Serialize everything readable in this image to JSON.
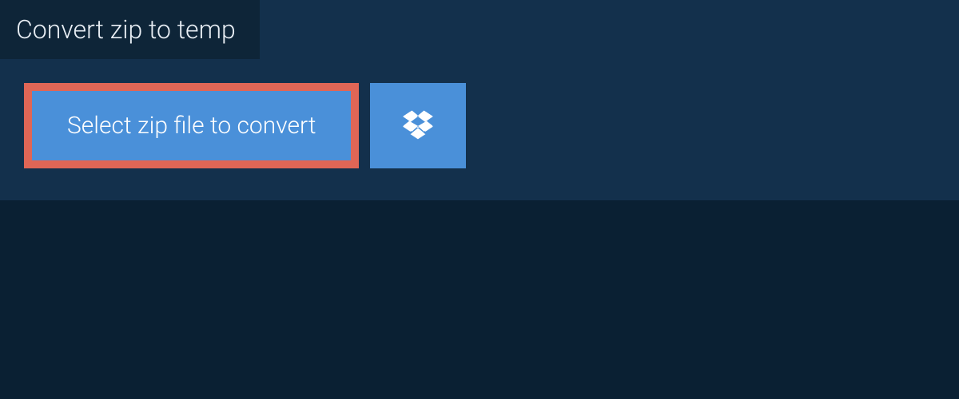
{
  "header": {
    "title": "Convert zip to temp"
  },
  "actions": {
    "select_file_label": "Select zip file to convert"
  },
  "colors": {
    "page_bg": "#0a2033",
    "panel_bg": "#13304c",
    "tab_bg": "#0e2538",
    "button_bg": "#4a90d9",
    "button_border": "#e06656",
    "text_light": "#ffffff"
  }
}
